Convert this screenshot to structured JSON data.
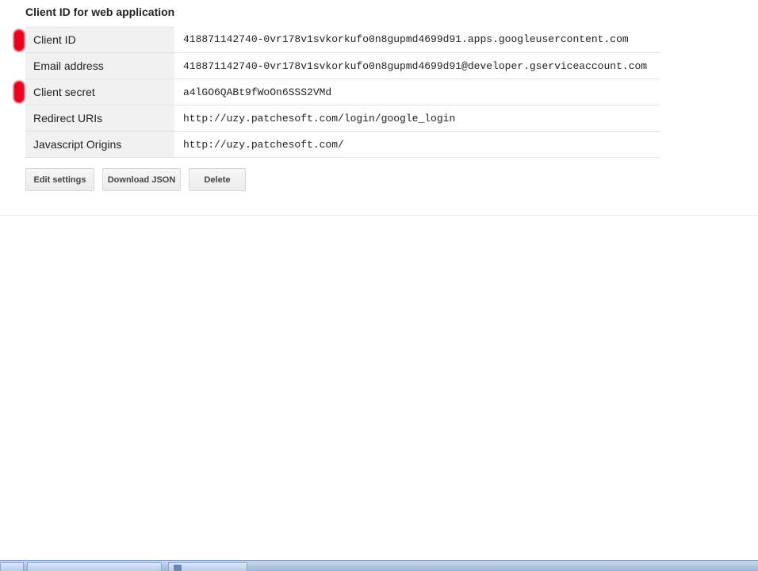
{
  "section": {
    "title": "Client ID for web application"
  },
  "rows": [
    {
      "label": "Client ID",
      "value": "418871142740-0vr178v1svkorkufo0n8gupmd4699d91.apps.googleusercontent.com"
    },
    {
      "label": "Email address",
      "value": "418871142740-0vr178v1svkorkufo0n8gupmd4699d91@developer.gserviceaccount.com"
    },
    {
      "label": "Client secret",
      "value": "a4lGO6QABt9fWoOn6SSS2VMd"
    },
    {
      "label": "Redirect URIs",
      "value": "http://uzy.patchesoft.com/login/google_login"
    },
    {
      "label": "Javascript Origins",
      "value": "http://uzy.patchesoft.com/"
    }
  ],
  "buttons": {
    "edit": "Edit settings",
    "download": "Download JSON",
    "delete": "Delete"
  },
  "colors": {
    "marker": "#e8001c",
    "label_bg": "#f1f1f1"
  }
}
